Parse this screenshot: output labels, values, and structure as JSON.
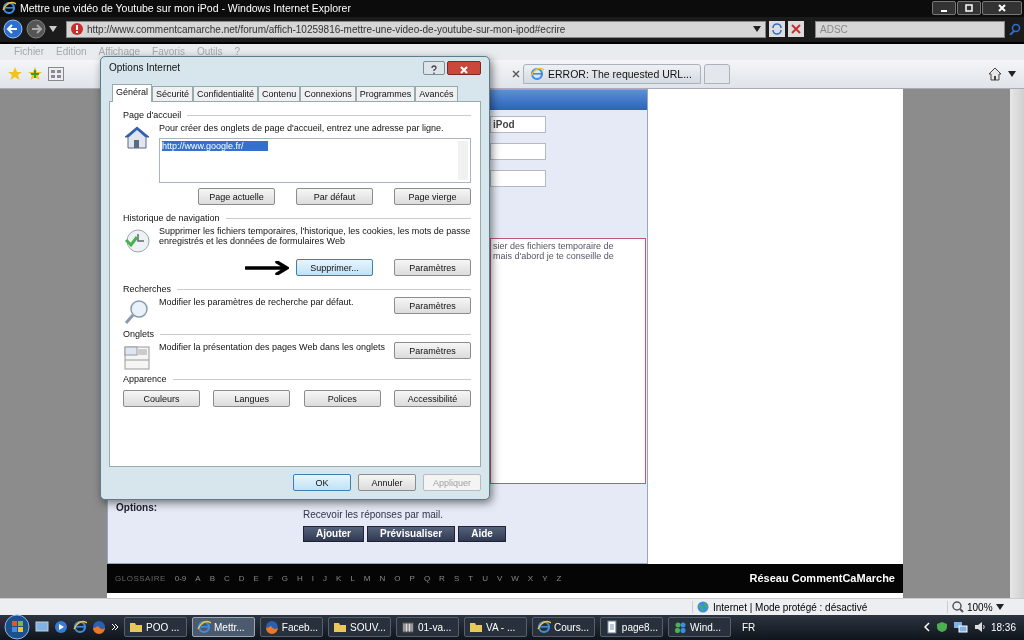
{
  "window": {
    "title": "Mettre une vidéo de Youtube sur mon iPod - Windows Internet Explorer"
  },
  "address_bar": {
    "url": "http://www.commentcamarche.net/forum/affich-10259816-mettre-une-video-de-youtube-sur-mon-ipod#ecrire"
  },
  "search": {
    "placeholder": "ADSC"
  },
  "menu": [
    {
      "label": "Fichier",
      "disabled": true
    },
    {
      "label": "Edition",
      "disabled": true
    },
    {
      "label": "Affichage",
      "disabled": true
    },
    {
      "label": "Favoris",
      "disabled": true
    },
    {
      "label": "Outils",
      "disabled": true
    },
    {
      "label": "?",
      "disabled": true
    }
  ],
  "tabs": [
    {
      "label": "ERROR: The requested URL...",
      "selected": false
    }
  ],
  "page": {
    "fields": [
      {
        "value": "iPod"
      }
    ],
    "message": [
      "sier des fichiers temporaire de",
      "mais d'abord je te conseille de"
    ],
    "options_label": "Options:",
    "notify_text": "Recevoir les réponses par mail.",
    "buttons": [
      "Ajouter",
      "Prévisualiser",
      "Aide"
    ],
    "footer": {
      "glossary_label": "GLOSSAIRE",
      "letters": [
        "0-9",
        "A",
        "B",
        "C",
        "D",
        "E",
        "F",
        "G",
        "H",
        "I",
        "J",
        "K",
        "L",
        "M",
        "N",
        "O",
        "P",
        "Q",
        "R",
        "S",
        "T",
        "U",
        "V",
        "W",
        "X",
        "Y",
        "Z"
      ],
      "network": "Réseau CommentCaMarche"
    }
  },
  "status_bar": {
    "zone": "Internet | Mode protégé : désactivé",
    "zoom": "100%"
  },
  "taskbar": {
    "tasks": [
      {
        "label": "POO ...",
        "selected": false
      },
      {
        "label": "Mettr...",
        "selected": true
      },
      {
        "label": "Faceb...",
        "selected": false
      },
      {
        "label": "SOUV...",
        "selected": false
      },
      {
        "label": "01-va...",
        "selected": false
      },
      {
        "label": "VA - ...",
        "selected": false
      },
      {
        "label": "Cours...",
        "selected": false
      },
      {
        "label": "page8...",
        "selected": false
      },
      {
        "label": "Wind...",
        "selected": false
      }
    ],
    "language": "FR",
    "clock": "18:36"
  },
  "dialog": {
    "title": "Options Internet",
    "tabs": [
      {
        "label": "Général",
        "selected": true
      },
      {
        "label": "Sécurité",
        "selected": false
      },
      {
        "label": "Confidentialité",
        "selected": false
      },
      {
        "label": "Contenu",
        "selected": false
      },
      {
        "label": "Connexions",
        "selected": false
      },
      {
        "label": "Programmes",
        "selected": false
      },
      {
        "label": "Avancés",
        "selected": false
      }
    ],
    "sections": [
      {
        "kind": "homepage",
        "title": "Page d'accueil",
        "text": "Pour créer des onglets de page d'accueil, entrez une adresse par ligne.",
        "value": "http://www.google.fr/",
        "buttons": [
          {
            "label": "Page actuelle",
            "highlighted": false
          },
          {
            "label": "Par défaut",
            "highlighted": false
          },
          {
            "label": "Page vierge",
            "highlighted": false
          }
        ]
      },
      {
        "kind": "history",
        "title": "Historique de navigation",
        "text": "Supprimer les fichiers temporaires, l'historique, les cookies, les mots de passe enregistrés et les données de formulaires Web",
        "buttons": [
          {
            "label": "Supprimer...",
            "highlighted": true
          },
          {
            "label": "Paramètres",
            "highlighted": false
          }
        ]
      },
      {
        "kind": "search",
        "title": "Recherches",
        "text": "Modifier les paramètres de recherche par défaut.",
        "buttons": [
          {
            "label": "Paramètres",
            "highlighted": false
          }
        ]
      },
      {
        "kind": "tabs",
        "title": "Onglets",
        "text": "Modifier la présentation des pages Web dans les onglets",
        "buttons": [
          {
            "label": "Paramètres",
            "highlighted": false
          }
        ]
      },
      {
        "kind": "buttons",
        "title": "Apparence",
        "buttons": [
          {
            "label": "Couleurs",
            "highlighted": false
          },
          {
            "label": "Langues",
            "highlighted": false
          },
          {
            "label": "Polices",
            "highlighted": false
          },
          {
            "label": "Accessibilité",
            "highlighted": false
          }
        ]
      }
    ],
    "buttons": [
      {
        "label": "OK",
        "default": true,
        "disabled": false
      },
      {
        "label": "Annuler",
        "default": false,
        "disabled": false
      },
      {
        "label": "Appliquer",
        "default": false,
        "disabled": true
      }
    ]
  }
}
